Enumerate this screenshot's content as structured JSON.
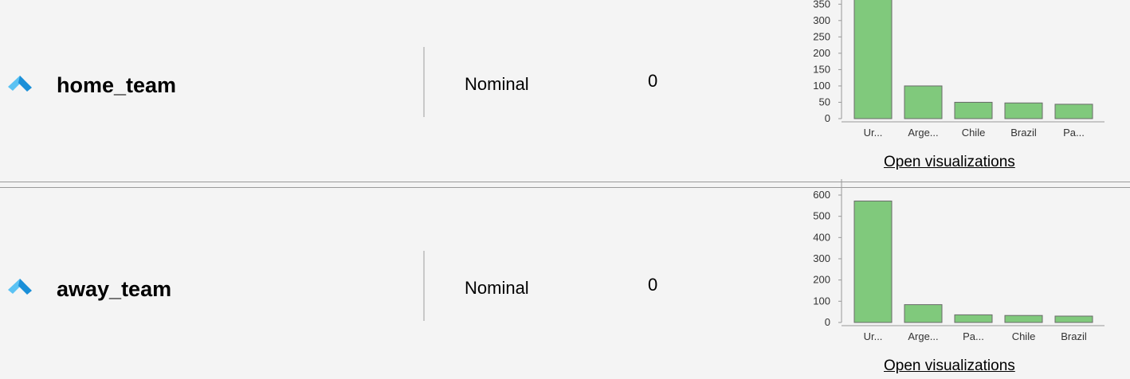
{
  "attributes": [
    {
      "name": "home_team",
      "type": "Nominal",
      "missing": "0",
      "open_visualizations": "Open visualizations",
      "chart_data": {
        "type": "bar",
        "categories": [
          "Ur...",
          "Arge...",
          "Chile",
          "Brazil",
          "Pa..."
        ],
        "values": [
          390,
          100,
          50,
          48,
          44
        ],
        "ylim": [
          0,
          375
        ],
        "yticks": [
          0,
          50,
          100,
          150,
          200,
          250,
          300,
          350
        ],
        "bar_color": "#80c97c"
      }
    },
    {
      "name": "away_team",
      "type": "Nominal",
      "missing": "0",
      "open_visualizations": "Open visualizations",
      "chart_data": {
        "type": "bar",
        "categories": [
          "Ur...",
          "Arge...",
          "Pa...",
          "Chile",
          "Brazil"
        ],
        "values": [
          572,
          84,
          36,
          33,
          30
        ],
        "ylim": [
          0,
          600
        ],
        "yticks": [
          0,
          100,
          200,
          300,
          400,
          500,
          600
        ],
        "bar_color": "#80c97c"
      }
    }
  ],
  "colors": {
    "caret_dark": "#1a8fd8",
    "caret_light": "#5bc2f3",
    "bar_fill": "#80c97c",
    "bar_stroke": "#6a6a6a"
  },
  "icons": {
    "caret": "chevron-up-icon"
  }
}
